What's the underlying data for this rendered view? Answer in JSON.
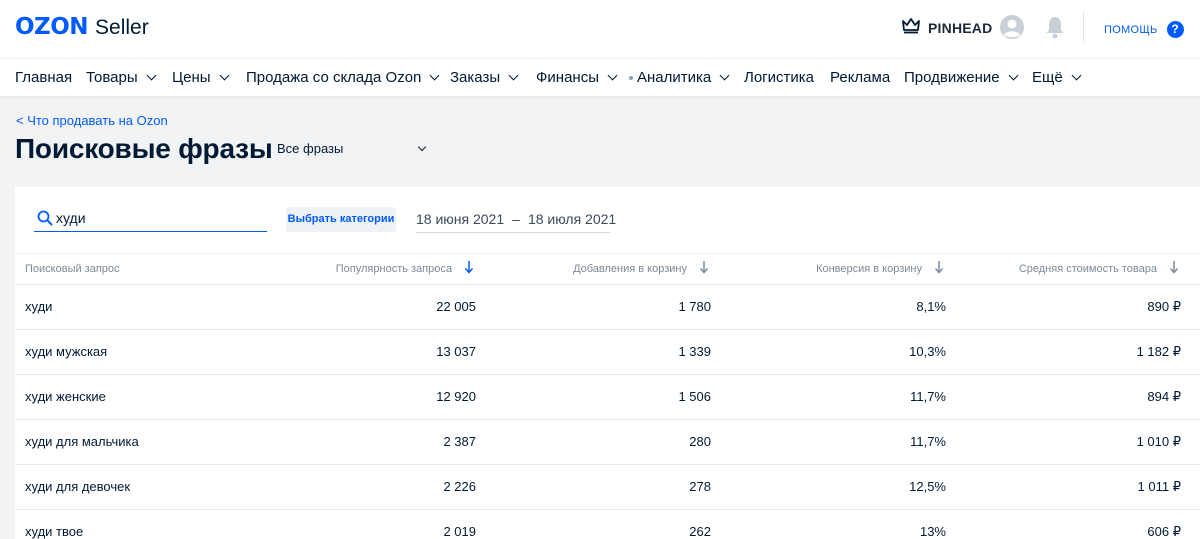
{
  "header": {
    "logo_brand": "OZON",
    "logo_product": "Seller",
    "account_name": "PINHEAD",
    "help_label": "ПОМОЩЬ",
    "help_icon": "?"
  },
  "nav": {
    "items": [
      {
        "label": "Главная",
        "dropdown": false
      },
      {
        "label": "Товары",
        "dropdown": true
      },
      {
        "label": "Цены",
        "dropdown": true
      },
      {
        "label": "Продажа со склада Ozon",
        "dropdown": true
      },
      {
        "label": "Заказы",
        "dropdown": true
      },
      {
        "label": "Финансы",
        "dropdown": true
      },
      {
        "label": "Аналитика",
        "dropdown": true
      },
      {
        "label": "Логистика",
        "dropdown": false
      },
      {
        "label": "Реклама",
        "dropdown": false
      },
      {
        "label": "Продвижение",
        "dropdown": true
      },
      {
        "label": "Ещё",
        "dropdown": true
      }
    ]
  },
  "page": {
    "back_link": "< Что продавать на Ozon",
    "title": "Поисковые фразы",
    "filter_value": "Все фразы"
  },
  "toolbar": {
    "search_value": "худи",
    "category_button": "Выбрать категории",
    "date_from": "18 июня 2021",
    "date_sep": "–",
    "date_to": "18 июля 2021"
  },
  "table": {
    "columns": [
      "Поисковый запрос",
      "Популярность запроса",
      "Добавления в корзину",
      "Конверсия в корзину",
      "Средняя стоимость товара"
    ],
    "rows": [
      {
        "query": "худи",
        "popularity": "22 005",
        "cart_adds": "1 780",
        "conversion": "8,1%",
        "avg_price": "890 ₽"
      },
      {
        "query": "худи мужская",
        "popularity": "13 037",
        "cart_adds": "1 339",
        "conversion": "10,3%",
        "avg_price": "1 182 ₽"
      },
      {
        "query": "худи женские",
        "popularity": "12 920",
        "cart_adds": "1 506",
        "conversion": "11,7%",
        "avg_price": "894 ₽"
      },
      {
        "query": "худи для мальчика",
        "popularity": "2 387",
        "cart_adds": "280",
        "conversion": "11,7%",
        "avg_price": "1 010 ₽"
      },
      {
        "query": "худи для девочек",
        "popularity": "2 226",
        "cart_adds": "278",
        "conversion": "12,5%",
        "avg_price": "1 011 ₽"
      },
      {
        "query": "худи твое",
        "popularity": "2 019",
        "cart_adds": "262",
        "conversion": "13%",
        "avg_price": "606 ₽"
      }
    ]
  },
  "colors": {
    "brand": "#005bff",
    "text": "#001a34",
    "muted": "#7b8a99",
    "background": "#f2f3f5"
  },
  "icons": [
    "crown-icon",
    "user-avatar-icon",
    "bell-icon",
    "help-icon",
    "search-icon",
    "sort-down-icon",
    "chevron-down-icon"
  ]
}
